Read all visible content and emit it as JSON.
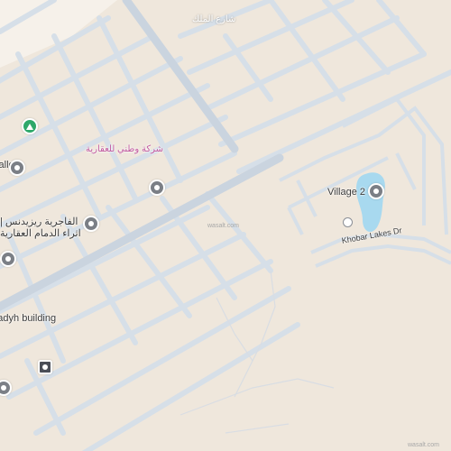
{
  "map": {
    "colors": {
      "background": "#efe7dc",
      "road": "#d4dde6",
      "road_major": "#c7d2de",
      "water": "#a8d9ef",
      "poi_green": "#2ea86a",
      "poi_gray": "#7b7f86"
    },
    "labels": {
      "top_street": "شارع الملك",
      "pink_poi": "شركة وطني للعقارية",
      "gallery": "Gallery",
      "arabic_line1": "الفاجرية ريزيدنس |",
      "arabic_line2": "اثراء الدمام العقارية",
      "building": "Al-Muhammadyh building",
      "village": "Village 2",
      "street": "Khobar Lakes Dr",
      "watermark_center": "wasalt.com",
      "watermark_corner": "wasalt.com"
    },
    "pois": [
      {
        "name": "green-poi",
        "icon": "tree-icon"
      },
      {
        "name": "gallery-poi",
        "icon": "pin-icon"
      },
      {
        "name": "pin-poi",
        "icon": "pin-icon"
      },
      {
        "name": "arabic-residence-poi",
        "icon": "pin-icon"
      },
      {
        "name": "building-poi",
        "icon": "building-icon"
      },
      {
        "name": "village-poi",
        "icon": "pin-icon"
      },
      {
        "name": "lower-left-poi",
        "icon": "pin-icon"
      },
      {
        "name": "lake-marker",
        "icon": "marker-icon"
      },
      {
        "name": "tag-poi",
        "icon": "tag-icon"
      }
    ]
  }
}
